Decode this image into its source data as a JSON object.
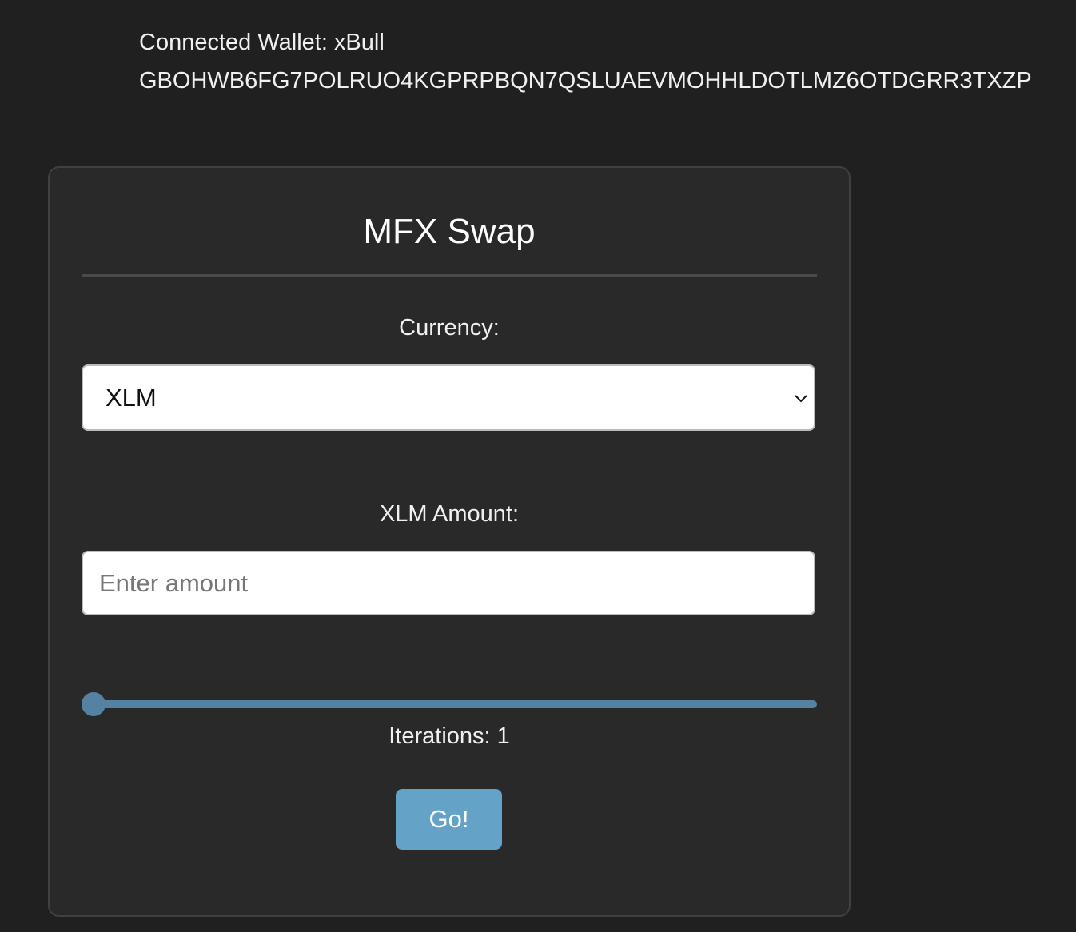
{
  "wallet": {
    "label": "Connected Wallet: xBull",
    "address": "GBOHWB6FG7POLRUO4KGPRPBQN7QSLUAEVMOHHLDOTLMZ6OTDGRR3TXZP"
  },
  "swap": {
    "title": "MFX Swap",
    "currency_label": "Currency:",
    "currency_value": "XLM",
    "amount_label": "XLM Amount:",
    "amount_placeholder": "Enter amount",
    "iterations_label": "Iterations: 1",
    "iterations_value": 1,
    "go_label": "Go!"
  },
  "colors": {
    "accent": "#65a2c8",
    "slider": "#5582a3",
    "background": "#202020",
    "card": "#292929"
  }
}
